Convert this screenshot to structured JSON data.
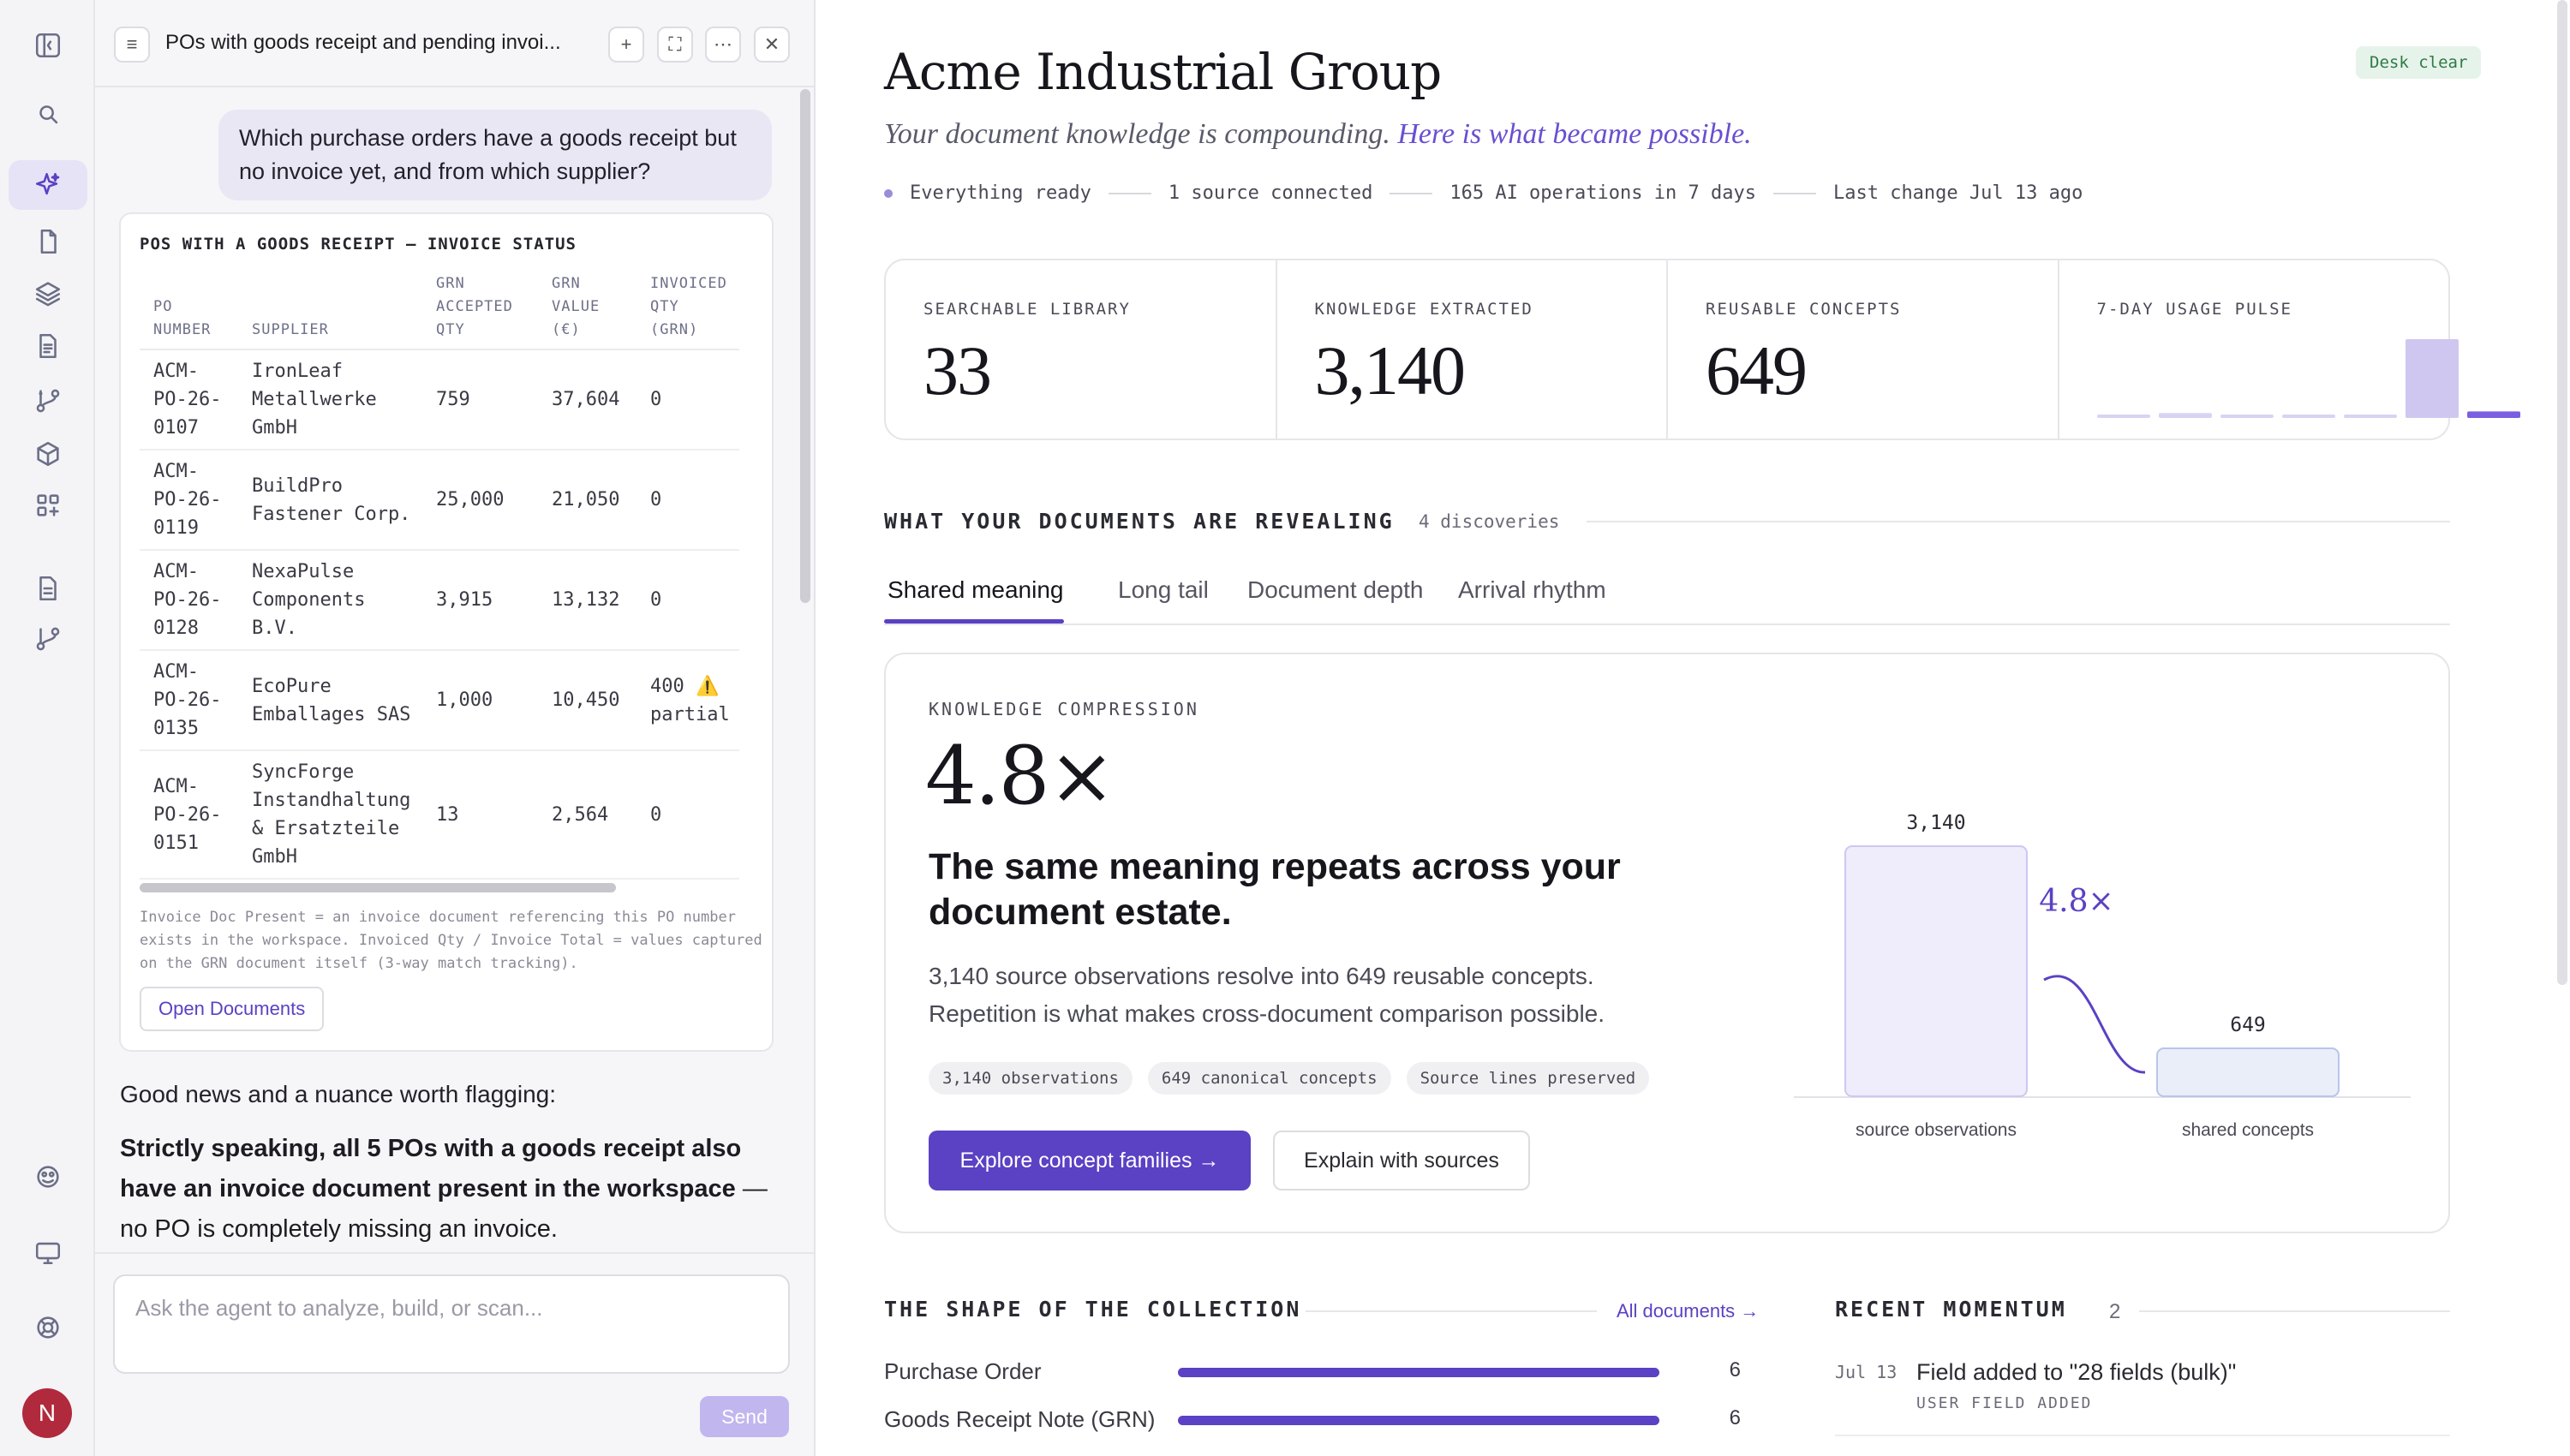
{
  "chat": {
    "title": "POs with goods receipt and pending invoi...",
    "user_message": "Which purchase orders have a goods receipt but no invoice yet, and from which supplier?",
    "card": {
      "title": "POS WITH A GOODS RECEIPT — INVOICE STATUS",
      "headers": [
        "PO NUMBER",
        "SUPPLIER",
        "GRN ACCEPTED QTY",
        "GRN VALUE (€)",
        "INVOICED QTY (GRN)"
      ],
      "rows": [
        {
          "po": "ACM-PO-26-0107",
          "supplier": "IronLeaf Metallwerke GmbH",
          "qty": "759",
          "value": "37,604",
          "invoiced": "0"
        },
        {
          "po": "ACM-PO-26-0119",
          "supplier": "BuildPro Fastener Corp.",
          "qty": "25,000",
          "value": "21,050",
          "invoiced": "0"
        },
        {
          "po": "ACM-PO-26-0128",
          "supplier": "NexaPulse Components B.V.",
          "qty": "3,915",
          "value": "13,132",
          "invoiced": "0"
        },
        {
          "po": "ACM-PO-26-0135",
          "supplier": "EcoPure Emballages SAS",
          "qty": "1,000",
          "value": "10,450",
          "invoiced": "400 ⚠️ partial"
        },
        {
          "po": "ACM-PO-26-0151",
          "supplier": "SyncForge Instandhaltung & Ersatzteile GmbH",
          "qty": "13",
          "value": "2,564",
          "invoiced": "0"
        }
      ],
      "note": "Invoice Doc Present = an invoice document referencing this PO number exists in the workspace. Invoiced Qty / Invoice Total = values captured on the GRN document itself (3-way match tracking).",
      "open_button": "Open Documents"
    },
    "good_news": "Good news and a nuance worth flagging:",
    "strict": "Strictly speaking, all 5 POs with a goods receipt also have an invoice document present in the workspace",
    "strict_tail": " — no PO is completely missing an invoice.",
    "composer_placeholder": "Ask the agent to analyze, build, or scan...",
    "send_label": "Send"
  },
  "rail": {
    "avatar_letter": "N"
  },
  "main": {
    "title": "Acme Industrial Group",
    "badge": "Desk clear",
    "tagline": "Your document knowledge is compounding.",
    "tagline_link": "Here is what became possible.",
    "status": [
      "Everything ready",
      "1 source connected",
      "165 AI operations in 7 days",
      "Last change Jul 13 ago"
    ],
    "stats": [
      {
        "label": "SEARCHABLE LIBRARY",
        "value": "33"
      },
      {
        "label": "KNOWLEDGE EXTRACTED",
        "value": "3,140"
      },
      {
        "label": "REUSABLE CONCEPTS",
        "value": "649"
      },
      {
        "label": "7-DAY USAGE PULSE"
      }
    ],
    "pulse_values": [
      2,
      3,
      2,
      2,
      2,
      48,
      4
    ],
    "revealing": {
      "title": "WHAT YOUR DOCUMENTS ARE REVEALING",
      "count": "4 discoveries"
    },
    "tabs": [
      "Shared meaning",
      "Long tail",
      "Document depth",
      "Arrival rhythm"
    ],
    "compression": {
      "label": "KNOWLEDGE COMPRESSION",
      "ratio": "4.8×",
      "headline": "The same meaning repeats across your document estate.",
      "desc": "3,140 source observations resolve into 649 reusable concepts. Repetition is what makes cross-document comparison possible.",
      "pills": [
        "3,140 observations",
        "649 canonical concepts",
        "Source lines preserved"
      ],
      "explore": "Explore concept families →",
      "explain": "Explain with sources"
    },
    "shape": {
      "title": "THE SHAPE OF THE COLLECTION",
      "link": "All documents →",
      "rows": [
        {
          "label": "Purchase Order",
          "count": "6",
          "fraction": 1.0
        },
        {
          "label": "Goods Receipt Note (GRN)",
          "count": "6",
          "fraction": 1.0
        }
      ]
    },
    "momentum": {
      "title": "RECENT MOMENTUM",
      "count": "2",
      "date": "Jul 13",
      "item": "Field added to \"28 fields (bulk)\"",
      "tag": "USER FIELD ADDED"
    }
  },
  "chart_data": {
    "type": "bar",
    "categories": [
      "source observations",
      "shared concepts"
    ],
    "values": [
      3140,
      649
    ],
    "annotation": "4.8×",
    "colors": {
      "accent": "#5b41c4",
      "bar1": "#efecfb",
      "bar2": "#eaeef9"
    }
  }
}
